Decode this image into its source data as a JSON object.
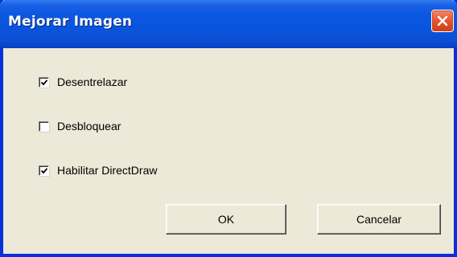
{
  "window": {
    "title": "Mejorar Imagen",
    "close_icon": "close-icon"
  },
  "options": [
    {
      "label": "Desentrelazar",
      "checked": true
    },
    {
      "label": "Desbloquear",
      "checked": false
    },
    {
      "label": "Habilitar DirectDraw",
      "checked": true
    }
  ],
  "buttons": {
    "ok_label": "OK",
    "cancel_label": "Cancelar"
  },
  "colors": {
    "titlebar": "#0a54dc",
    "window_bg": "#ece9d8",
    "close_button": "#e55a33"
  }
}
